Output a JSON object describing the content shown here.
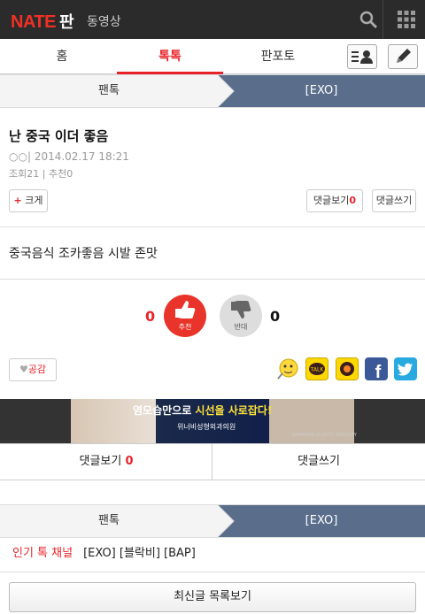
{
  "header": {
    "logo": "NATE",
    "logo_suffix": "판",
    "video_label": "동영상"
  },
  "tabs": [
    {
      "label": "홈"
    },
    {
      "label": "톡톡",
      "active": true
    },
    {
      "label": "판포토"
    }
  ],
  "breadcrumb": {
    "left": "팬톡",
    "right": "[EXO]"
  },
  "post": {
    "title": "난 중국 이더 좋음",
    "author": "○○",
    "date": "2014.02.17 18:21",
    "views_label": "조회21",
    "recommend_label": "추천0",
    "size_button": "크게",
    "size_plus": "+",
    "comments_view_label": "댓글보기",
    "comments_count": "0",
    "comment_write_label": "댓글쓰기",
    "body": "중국음식 조카좋음 시발 존맛"
  },
  "vote": {
    "up_count": "0",
    "up_label": "추천",
    "down_count": "0",
    "down_label": "반대"
  },
  "empathy": {
    "label": "공감"
  },
  "banner": {
    "line1a": "염모습만으로 ",
    "line1b": "시선을 사로잡다!",
    "line2": "위너비성형외과의원",
    "line3": "WANNABE PLASTIC SURGERY"
  },
  "bottom_comments": {
    "view_label": "댓글보기",
    "count": "0",
    "write_label": "댓글쓰기"
  },
  "breadcrumb2": {
    "left": "팬톡",
    "right": "[EXO]"
  },
  "channel": {
    "label": "인기 톡 채널",
    "items": "[EXO] [블락비] [BAP]"
  },
  "list_button": "최신글 목록보기",
  "colors": {
    "accent": "#e8242a",
    "crumb_active": "#5a6e8c",
    "topbar": "#2b2b2b"
  }
}
